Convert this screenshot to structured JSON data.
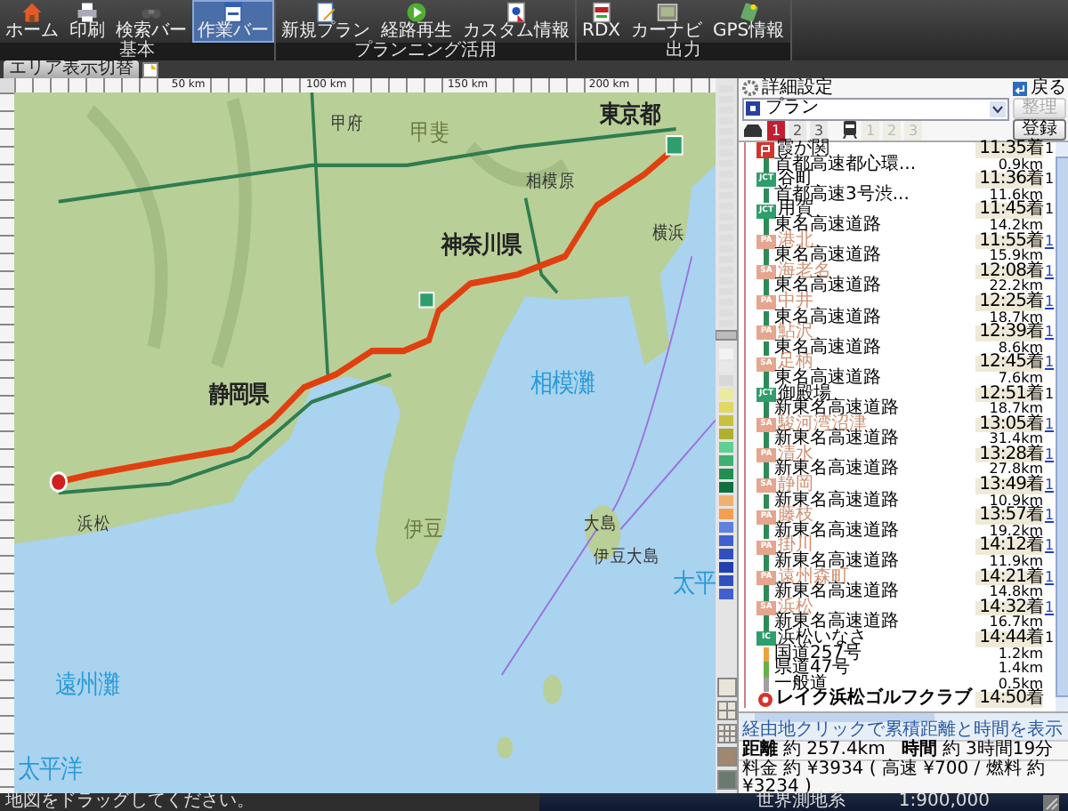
{
  "toolbar": {
    "groups": [
      {
        "label": "基本",
        "buttons": [
          {
            "kind": "home",
            "label": "ホーム",
            "selected": false
          },
          {
            "kind": "print",
            "label": "印刷",
            "selected": false
          },
          {
            "kind": "searchbar",
            "label": "検索バー",
            "selected": false
          },
          {
            "kind": "workbar",
            "label": "作業バー",
            "selected": true
          }
        ]
      },
      {
        "label": "プランニング活用",
        "buttons": [
          {
            "kind": "newplan",
            "label": "新規プラン",
            "selected": false
          },
          {
            "kind": "replay",
            "label": "経路再生",
            "selected": false
          },
          {
            "kind": "custom",
            "label": "カスタム情報",
            "selected": false
          }
        ]
      },
      {
        "label": "出力",
        "buttons": [
          {
            "kind": "rdx",
            "label": "RDX",
            "selected": false
          },
          {
            "kind": "carnavi",
            "label": "カーナビ",
            "selected": false
          },
          {
            "kind": "gps",
            "label": "GPS情報",
            "selected": false
          }
        ]
      }
    ]
  },
  "map_tab": {
    "label": "エリア表示切替"
  },
  "ruler": {
    "top_labels": [
      "50 km",
      "100 km",
      "150 km",
      "200 km"
    ]
  },
  "map": {
    "labels": [
      {
        "kind": "city",
        "text": "甲府"
      },
      {
        "kind": "region",
        "text": "甲斐"
      },
      {
        "kind": "city",
        "text": "相模原"
      },
      {
        "kind": "pref",
        "text": "神奈川県"
      },
      {
        "kind": "pref",
        "text": "静岡県"
      },
      {
        "kind": "pref",
        "text": "東京都"
      },
      {
        "kind": "city",
        "text": "横浜"
      },
      {
        "kind": "sea",
        "text": "相模灘"
      },
      {
        "kind": "region",
        "text": "伊豆"
      },
      {
        "kind": "city",
        "text": "大島"
      },
      {
        "kind": "city",
        "text": "伊豆大島"
      },
      {
        "kind": "city",
        "text": "浜松"
      },
      {
        "kind": "sea",
        "text": "遠州灘"
      },
      {
        "kind": "sea",
        "text": "太平洋"
      },
      {
        "kind": "sea",
        "text": "太平"
      }
    ]
  },
  "panel": {
    "title": "詳細設定",
    "back_button": "戻る",
    "plan_select": {
      "value": "プラン"
    },
    "organize_button": {
      "label": "整理",
      "disabled": true
    },
    "route_tabs": [
      {
        "label": "1",
        "selected": true
      },
      {
        "label": "2",
        "selected": false
      },
      {
        "label": "3",
        "selected": false
      }
    ],
    "train_tabs": [
      {
        "label": "1",
        "disabled": true
      },
      {
        "label": "2",
        "disabled": true
      },
      {
        "label": "3",
        "disabled": true
      }
    ],
    "register_button": "登録",
    "route": [
      {
        "kind": "start",
        "name": "霞が関",
        "time": "11:35着",
        "mark": "1"
      },
      {
        "kind": "road",
        "name": "首都高速都心環...",
        "distance": "0.9km",
        "color": "#2e8b57"
      },
      {
        "kind": "jct",
        "badge": "JCT",
        "name": "谷町",
        "time": "11:36着",
        "mark": "1"
      },
      {
        "kind": "road",
        "name": "首都高速3号渋...",
        "distance": "11.6km",
        "color": "#2e8b57"
      },
      {
        "kind": "jct",
        "badge": "JCT",
        "name": "用賀",
        "time": "11:45着",
        "mark": "1"
      },
      {
        "kind": "road",
        "name": "東名高速道路",
        "distance": "14.2km",
        "color": "#2e8b57"
      },
      {
        "kind": "pa",
        "badge": "PA",
        "name": "港北",
        "time": "11:55着",
        "mark": "1"
      },
      {
        "kind": "road",
        "name": "東名高速道路",
        "distance": "15.9km",
        "color": "#2e8b57"
      },
      {
        "kind": "sa",
        "badge": "SA",
        "name": "海老名",
        "time": "12:08着",
        "mark": "1"
      },
      {
        "kind": "road",
        "name": "東名高速道路",
        "distance": "22.2km",
        "color": "#2e8b57"
      },
      {
        "kind": "pa",
        "badge": "PA",
        "name": "中井",
        "time": "12:25着",
        "mark": "1"
      },
      {
        "kind": "road",
        "name": "東名高速道路",
        "distance": "18.7km",
        "color": "#2e8b57"
      },
      {
        "kind": "pa",
        "badge": "PA",
        "name": "鮎沢",
        "time": "12:39着",
        "mark": "1"
      },
      {
        "kind": "road",
        "name": "東名高速道路",
        "distance": "8.6km",
        "color": "#2e8b57"
      },
      {
        "kind": "sa",
        "badge": "SA",
        "name": "足柄",
        "time": "12:45着",
        "mark": "1"
      },
      {
        "kind": "road",
        "name": "東名高速道路",
        "distance": "7.6km",
        "color": "#2e8b57"
      },
      {
        "kind": "jct",
        "badge": "JCT",
        "name": "御殿場",
        "time": "12:51着",
        "mark": "1"
      },
      {
        "kind": "road",
        "name": "新東名高速道路",
        "distance": "18.7km",
        "color": "#2e8b57"
      },
      {
        "kind": "sa",
        "badge": "SA",
        "name": "駿河湾沼津",
        "time": "13:05着",
        "mark": "1"
      },
      {
        "kind": "road",
        "name": "新東名高速道路",
        "distance": "31.4km",
        "color": "#2e8b57"
      },
      {
        "kind": "pa",
        "badge": "PA",
        "name": "清水",
        "time": "13:28着",
        "mark": "1"
      },
      {
        "kind": "road",
        "name": "新東名高速道路",
        "distance": "27.8km",
        "color": "#2e8b57"
      },
      {
        "kind": "sa",
        "badge": "SA",
        "name": "静岡",
        "time": "13:49着",
        "mark": "1"
      },
      {
        "kind": "road",
        "name": "新東名高速道路",
        "distance": "10.9km",
        "color": "#2e8b57"
      },
      {
        "kind": "pa",
        "badge": "PA",
        "name": "藤枝",
        "time": "13:57着",
        "mark": "1"
      },
      {
        "kind": "road",
        "name": "新東名高速道路",
        "distance": "19.2km",
        "color": "#2e8b57"
      },
      {
        "kind": "pa",
        "badge": "PA",
        "name": "掛川",
        "time": "14:12着",
        "mark": "1"
      },
      {
        "kind": "road",
        "name": "新東名高速道路",
        "distance": "11.9km",
        "color": "#2e8b57"
      },
      {
        "kind": "pa",
        "badge": "PA",
        "name": "遠州森町",
        "time": "14:21着",
        "mark": "1"
      },
      {
        "kind": "road",
        "name": "新東名高速道路",
        "distance": "14.8km",
        "color": "#2e8b57"
      },
      {
        "kind": "sa",
        "badge": "SA",
        "name": "浜松",
        "time": "14:32着",
        "mark": "1"
      },
      {
        "kind": "road",
        "name": "新東名高速道路",
        "distance": "16.7km",
        "color": "#2e8b57"
      },
      {
        "kind": "ic",
        "badge": "IC",
        "name": "浜松いなさ",
        "time": "14:44着",
        "mark": "1"
      },
      {
        "kind": "road",
        "name": "国道257号",
        "distance": "1.2km",
        "color": "#e8a33d"
      },
      {
        "kind": "road",
        "name": "県道47号",
        "distance": "1.4km",
        "color": "#6ab04c"
      },
      {
        "kind": "road",
        "name": "一般道",
        "distance": "0.5km",
        "color": "#a0a0a0"
      },
      {
        "kind": "goal",
        "name": "レイク浜松ゴルフクラブ",
        "time": "14:50着"
      }
    ],
    "hint": "経由地クリックで累積距離と時間を表示",
    "distance_label": "距離",
    "distance": "約 257.4km",
    "time_label": "時間",
    "time": "約 3時間19分",
    "fare": "料金 約 ¥3934 ( 高速 ¥700 / 燃料 約 ¥3234 )"
  },
  "status_bar": {
    "message": "地図をドラッグしてください。",
    "datum": "世界測地系",
    "scale": "1:900,000"
  }
}
